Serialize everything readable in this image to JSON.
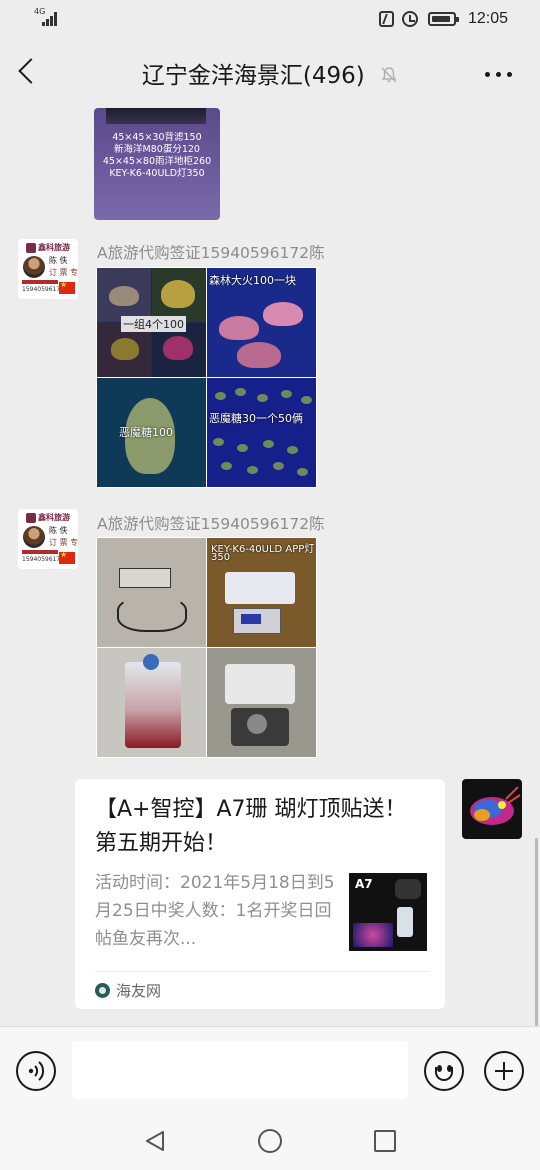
{
  "status_bar": {
    "network": "4G",
    "time": "12:05",
    "icons": [
      "signal-icon",
      "nfc-icon",
      "alarm-icon",
      "battery-icon"
    ]
  },
  "header": {
    "title": "辽宁金洋海景汇(496)",
    "icons": [
      "back-icon",
      "mute-icon",
      "more-icon"
    ]
  },
  "messages": [
    {
      "type": "image",
      "image_lines": [
        "45×45×30背滤150",
        "新海洋M80蛋分120",
        "45×45×80雨洋地柜260",
        "KEY-K6-40ULD灯350"
      ]
    },
    {
      "type": "image_grid",
      "sender": "A旅游代购签证15940596172陈",
      "avatar": {
        "logo_text": "鑫科旅游",
        "name": "陈 佚",
        "title": "订 票 专 员",
        "phone": "15940596172"
      },
      "labels": [
        "一组4个100",
        "森林大火100一块",
        "恶魔糖100",
        "恶魔糖30一个50俩"
      ]
    },
    {
      "type": "image_grid",
      "sender": "A旅游代购签证15940596172陈",
      "avatar": {
        "logo_text": "鑫科旅游",
        "name": "陈 佚",
        "title": "订 票 专 员",
        "phone": "15940596172"
      },
      "labels": [
        "KEY-K6-40ULD APP灯",
        "350"
      ]
    },
    {
      "type": "link_card",
      "title": "【A+智控】A7珊 瑚灯顶贴送！第五期开始！",
      "description": "活动时间：2021年5月18日到5月25日中奖人数：1名开奖日回帖鱼友再次...",
      "thumb_label": "A7",
      "source": "海友网"
    }
  ],
  "input_bar": {
    "input_value": "",
    "icons": [
      "voice-icon",
      "emoji-icon",
      "plus-icon"
    ]
  },
  "nav_bar": {
    "icons": [
      "nav-back-icon",
      "nav-home-icon",
      "nav-recents-icon"
    ]
  },
  "colors": {
    "background": "#ededed",
    "bubble": "#ffffff",
    "sender_text": "#8c8c8c",
    "card_desc": "#8f8f8f"
  }
}
